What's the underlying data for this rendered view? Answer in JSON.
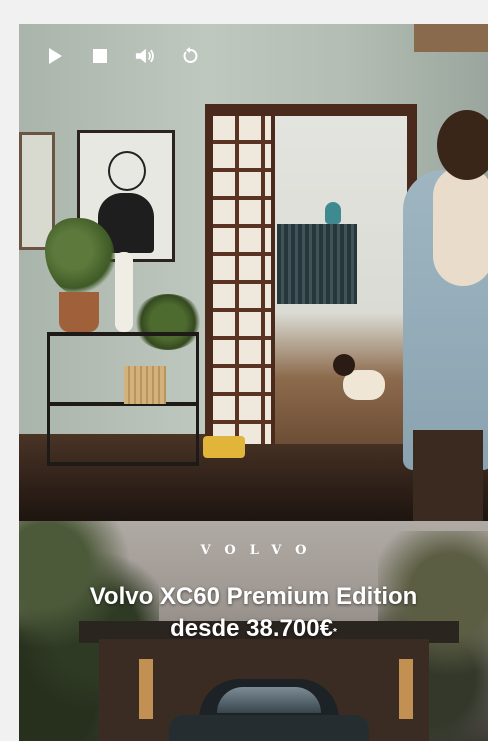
{
  "player": {
    "controls": [
      {
        "name": "play-icon",
        "label": "Play"
      },
      {
        "name": "stop-icon",
        "label": "Stop"
      },
      {
        "name": "volume-icon",
        "label": "Mute"
      },
      {
        "name": "replay-icon",
        "label": "Replay"
      }
    ]
  },
  "promo": {
    "brand": "VOLVO",
    "headline_line1": "Volvo XC60 Premium Edition",
    "headline_line2": "desde 38.700€",
    "footnote_mark": "*"
  },
  "colors": {
    "text": "#ffffff",
    "page_background": "#f1f1f1"
  }
}
